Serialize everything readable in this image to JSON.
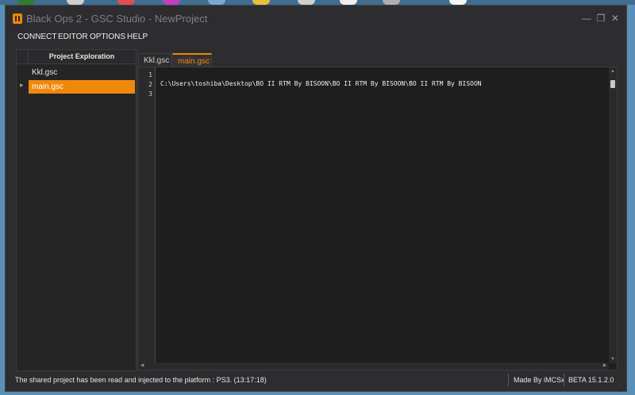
{
  "window": {
    "title": "Black Ops 2 - GSC Studio - NewProject",
    "minimize_glyph": "—",
    "restore_glyph": "❐",
    "close_glyph": "✕"
  },
  "menu": [
    {
      "label": "CONNECT"
    },
    {
      "label": "EDITOR"
    },
    {
      "label": "OPTIONS"
    },
    {
      "label": "HELP"
    }
  ],
  "project_panel": {
    "header": "Project Exploration",
    "items": [
      {
        "label": "Kkl.gsc",
        "selected": false
      },
      {
        "label": "main.gsc",
        "selected": true
      }
    ]
  },
  "tabs": [
    {
      "label": "Kkl.gsc",
      "active": false
    },
    {
      "label": "main.gsc",
      "active": true
    }
  ],
  "editor": {
    "line_numbers": [
      "1",
      "2",
      "3"
    ],
    "lines": [
      "",
      "C:\\Users\\toshiba\\Desktop\\BO II RTM By BISOON\\BO II RTM By BISOON\\BO II RTM By BISOON",
      ""
    ]
  },
  "status": {
    "message": "The shared project has been read and injected to the platform : PS3. (13:17:18)",
    "author": "Made By iMCSx",
    "version": "BETA 15.1.2.0"
  },
  "colors": {
    "accent": "#f0880a",
    "background": "#2d2d30",
    "editor_bg": "#1e1e1e"
  }
}
